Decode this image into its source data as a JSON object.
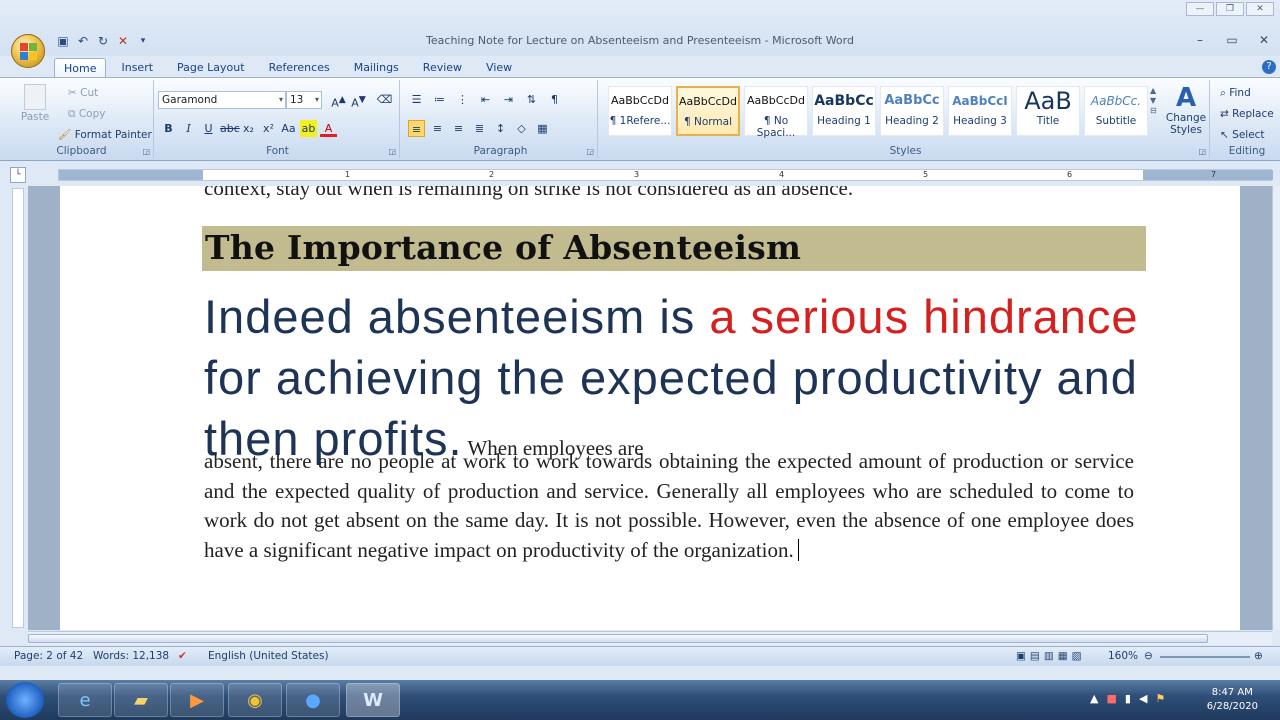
{
  "window": {
    "title": "Teaching Note for Lecture on Absenteeism and Presenteeism  -  Microsoft Word"
  },
  "tabs": [
    "Home",
    "Insert",
    "Page Layout",
    "References",
    "Mailings",
    "Review",
    "View"
  ],
  "clipboard": {
    "label": "Clipboard",
    "paste": "Paste",
    "cut": "Cut",
    "copy": "Copy",
    "format_painter": "Format Painter"
  },
  "font": {
    "label": "Font",
    "name": "Garamond",
    "size": "13"
  },
  "paragraph": {
    "label": "Paragraph"
  },
  "styles": {
    "label": "Styles",
    "items": [
      {
        "preview": "AaBbCcDd",
        "name": "¶ 1Refere..."
      },
      {
        "preview": "AaBbCcDd",
        "name": "¶ Normal"
      },
      {
        "preview": "AaBbCcDd",
        "name": "¶ No Spaci..."
      },
      {
        "preview": "AaBbCc",
        "name": "Heading 1"
      },
      {
        "preview": "AaBbCc",
        "name": "Heading 2"
      },
      {
        "preview": "AaBbCcI",
        "name": "Heading 3"
      },
      {
        "preview": "AaB",
        "name": "Title"
      },
      {
        "preview": "AaBbCc.",
        "name": "Subtitle"
      }
    ],
    "change_styles": "Change Styles"
  },
  "editing": {
    "label": "Editing",
    "find": "Find",
    "replace": "Replace",
    "select": "Select"
  },
  "ruler": {
    "numbers": [
      "1",
      "2",
      "3",
      "4",
      "5",
      "6",
      "7"
    ]
  },
  "document": {
    "cut_line": "context, stay out when is remaining on strike is not considered as an absence.",
    "heading": "The Importance of Absenteeism",
    "big_1": "Indeed absenteeism is ",
    "big_red_1": "a serious hindrance",
    "big_2": " for achieving the expected productivity and then profits.",
    "small_inline": " When employees are",
    "body": "absent, there are no people at work to work towards obtaining the expected amount of production or service and the expected quality of production and service. Generally all employees who are scheduled to come to work do not get absent on the same day. It is not possible. However, even the absence of one employee does have a significant negative impact on productivity of the organization."
  },
  "status": {
    "page": "Page: 2 of 42",
    "words": "Words: 12,138",
    "language": "English (United States)",
    "zoom": "160%"
  },
  "taskbar": {
    "time": "8:47 AM",
    "date": "6/28/2020"
  }
}
